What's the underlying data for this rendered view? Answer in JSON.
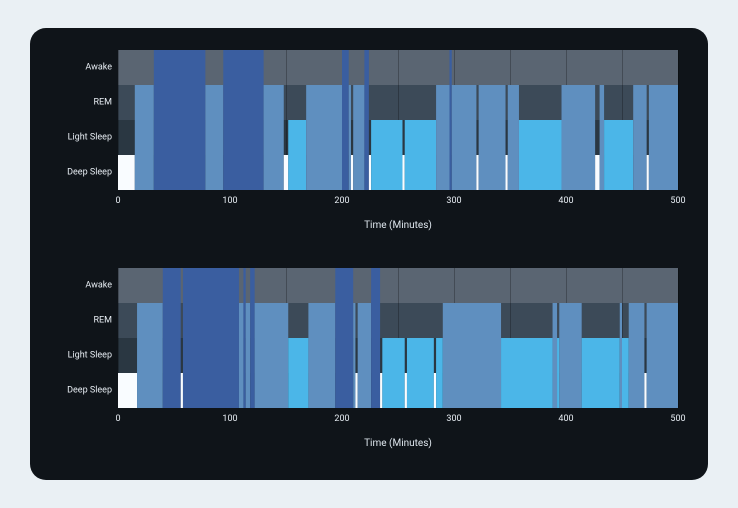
{
  "chart_data": [
    {
      "type": "area",
      "title": "",
      "xlabel": "Time (Minutes)",
      "ylabel": "",
      "xlim": [
        0,
        500
      ],
      "x_ticks": [
        0,
        100,
        200,
        300,
        400,
        500
      ],
      "stages": [
        "Awake",
        "REM",
        "Light Sleep",
        "Deep Sleep"
      ],
      "stage_colors": {
        "Awake": "#f9fcff",
        "REM": "#4bb6e8",
        "Light Sleep": "#5f8fbf",
        "Deep Sleep": "#3a5ea0"
      },
      "segments": [
        {
          "start": 0,
          "end": 15,
          "stage": "Awake"
        },
        {
          "start": 15,
          "end": 32,
          "stage": "Light Sleep"
        },
        {
          "start": 32,
          "end": 78,
          "stage": "Deep Sleep"
        },
        {
          "start": 78,
          "end": 94,
          "stage": "Light Sleep"
        },
        {
          "start": 94,
          "end": 130,
          "stage": "Deep Sleep"
        },
        {
          "start": 130,
          "end": 148,
          "stage": "Light Sleep"
        },
        {
          "start": 148,
          "end": 152,
          "stage": "Awake"
        },
        {
          "start": 152,
          "end": 168,
          "stage": "REM"
        },
        {
          "start": 168,
          "end": 200,
          "stage": "Light Sleep"
        },
        {
          "start": 200,
          "end": 206,
          "stage": "Deep Sleep"
        },
        {
          "start": 206,
          "end": 208,
          "stage": "Light Sleep"
        },
        {
          "start": 208,
          "end": 210,
          "stage": "Awake"
        },
        {
          "start": 210,
          "end": 220,
          "stage": "Light Sleep"
        },
        {
          "start": 220,
          "end": 224,
          "stage": "Deep Sleep"
        },
        {
          "start": 224,
          "end": 226,
          "stage": "Awake"
        },
        {
          "start": 226,
          "end": 254,
          "stage": "REM"
        },
        {
          "start": 254,
          "end": 256,
          "stage": "Awake"
        },
        {
          "start": 256,
          "end": 284,
          "stage": "REM"
        },
        {
          "start": 284,
          "end": 296,
          "stage": "Light Sleep"
        },
        {
          "start": 296,
          "end": 298,
          "stage": "Deep Sleep"
        },
        {
          "start": 298,
          "end": 320,
          "stage": "Light Sleep"
        },
        {
          "start": 320,
          "end": 322,
          "stage": "Awake"
        },
        {
          "start": 322,
          "end": 346,
          "stage": "Light Sleep"
        },
        {
          "start": 346,
          "end": 348,
          "stage": "Awake"
        },
        {
          "start": 348,
          "end": 358,
          "stage": "Light Sleep"
        },
        {
          "start": 358,
          "end": 396,
          "stage": "REM"
        },
        {
          "start": 396,
          "end": 426,
          "stage": "Light Sleep"
        },
        {
          "start": 426,
          "end": 430,
          "stage": "Awake"
        },
        {
          "start": 430,
          "end": 434,
          "stage": "Light Sleep"
        },
        {
          "start": 434,
          "end": 460,
          "stage": "REM"
        },
        {
          "start": 460,
          "end": 472,
          "stage": "Light Sleep"
        },
        {
          "start": 472,
          "end": 474,
          "stage": "Awake"
        },
        {
          "start": 474,
          "end": 500,
          "stage": "Light Sleep"
        }
      ]
    },
    {
      "type": "area",
      "title": "",
      "xlabel": "Time (Minutes)",
      "ylabel": "",
      "xlim": [
        0,
        500
      ],
      "x_ticks": [
        0,
        100,
        200,
        300,
        400,
        500
      ],
      "stages": [
        "Awake",
        "REM",
        "Light Sleep",
        "Deep Sleep"
      ],
      "stage_colors": {
        "Awake": "#f9fcff",
        "REM": "#4bb6e8",
        "Light Sleep": "#5f8fbf",
        "Deep Sleep": "#3a5ea0"
      },
      "segments": [
        {
          "start": 0,
          "end": 17,
          "stage": "Awake"
        },
        {
          "start": 17,
          "end": 40,
          "stage": "Light Sleep"
        },
        {
          "start": 40,
          "end": 56,
          "stage": "Deep Sleep"
        },
        {
          "start": 56,
          "end": 58,
          "stage": "Awake"
        },
        {
          "start": 58,
          "end": 108,
          "stage": "Deep Sleep"
        },
        {
          "start": 108,
          "end": 112,
          "stage": "Light Sleep"
        },
        {
          "start": 112,
          "end": 114,
          "stage": "Deep Sleep"
        },
        {
          "start": 114,
          "end": 118,
          "stage": "Light Sleep"
        },
        {
          "start": 118,
          "end": 122,
          "stage": "Deep Sleep"
        },
        {
          "start": 122,
          "end": 152,
          "stage": "Light Sleep"
        },
        {
          "start": 152,
          "end": 170,
          "stage": "REM"
        },
        {
          "start": 170,
          "end": 194,
          "stage": "Light Sleep"
        },
        {
          "start": 194,
          "end": 210,
          "stage": "Deep Sleep"
        },
        {
          "start": 210,
          "end": 212,
          "stage": "Light Sleep"
        },
        {
          "start": 212,
          "end": 214,
          "stage": "Awake"
        },
        {
          "start": 214,
          "end": 226,
          "stage": "Light Sleep"
        },
        {
          "start": 226,
          "end": 234,
          "stage": "Deep Sleep"
        },
        {
          "start": 234,
          "end": 236,
          "stage": "Awake"
        },
        {
          "start": 236,
          "end": 256,
          "stage": "REM"
        },
        {
          "start": 256,
          "end": 258,
          "stage": "Awake"
        },
        {
          "start": 258,
          "end": 282,
          "stage": "REM"
        },
        {
          "start": 282,
          "end": 284,
          "stage": "Awake"
        },
        {
          "start": 284,
          "end": 290,
          "stage": "REM"
        },
        {
          "start": 290,
          "end": 342,
          "stage": "Light Sleep"
        },
        {
          "start": 342,
          "end": 388,
          "stage": "REM"
        },
        {
          "start": 388,
          "end": 392,
          "stage": "Light Sleep"
        },
        {
          "start": 392,
          "end": 394,
          "stage": "REM"
        },
        {
          "start": 394,
          "end": 414,
          "stage": "Light Sleep"
        },
        {
          "start": 414,
          "end": 448,
          "stage": "REM"
        },
        {
          "start": 448,
          "end": 450,
          "stage": "Light Sleep"
        },
        {
          "start": 450,
          "end": 456,
          "stage": "REM"
        },
        {
          "start": 456,
          "end": 470,
          "stage": "Light Sleep"
        },
        {
          "start": 470,
          "end": 472,
          "stage": "Awake"
        },
        {
          "start": 472,
          "end": 500,
          "stage": "Light Sleep"
        }
      ]
    }
  ]
}
